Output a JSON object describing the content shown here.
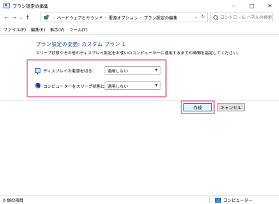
{
  "window": {
    "title": "プラン設定の編集",
    "controls": {
      "minimize": "–",
      "maximize": "□",
      "close": "✕"
    }
  },
  "nav": {
    "back": "←",
    "forward": "→",
    "dropdown": "⌄",
    "up": "↑",
    "breadcrumb": [
      "ハードウェアとサウンド",
      "電源オプション",
      "プラン設定の編集"
    ],
    "crumb_separator": "›",
    "address_dropdown": "⌄",
    "refresh": "↻",
    "search_placeholder": "コントロール パネルの検索"
  },
  "menu": {
    "items": [
      "ファイル(F)",
      "編集(E)",
      "表示(V)",
      "ツール(T)"
    ]
  },
  "content": {
    "title": "プラン設定の変更: カスタム プラン 1",
    "description": "スリープ状態やその他のディスプレイ設定をお使いのコンピューターに適用するまでの時間を指定してください。",
    "settings": [
      {
        "label": "ディスプレイの電源を切る:",
        "value": "適用しない",
        "icon": "monitor-icon"
      },
      {
        "label": "コンピューターをスリープ状態にする:",
        "value": "適用しない",
        "icon": "moon-icon"
      }
    ],
    "create_button": "作成",
    "cancel_button": "キャンセル"
  },
  "status": {
    "count": "0 個の項目",
    "location": "コンピューター"
  },
  "colors": {
    "title_blue": "#1e4f9a",
    "highlight_pink": "#e98fb8",
    "accent": "#0078d7"
  }
}
